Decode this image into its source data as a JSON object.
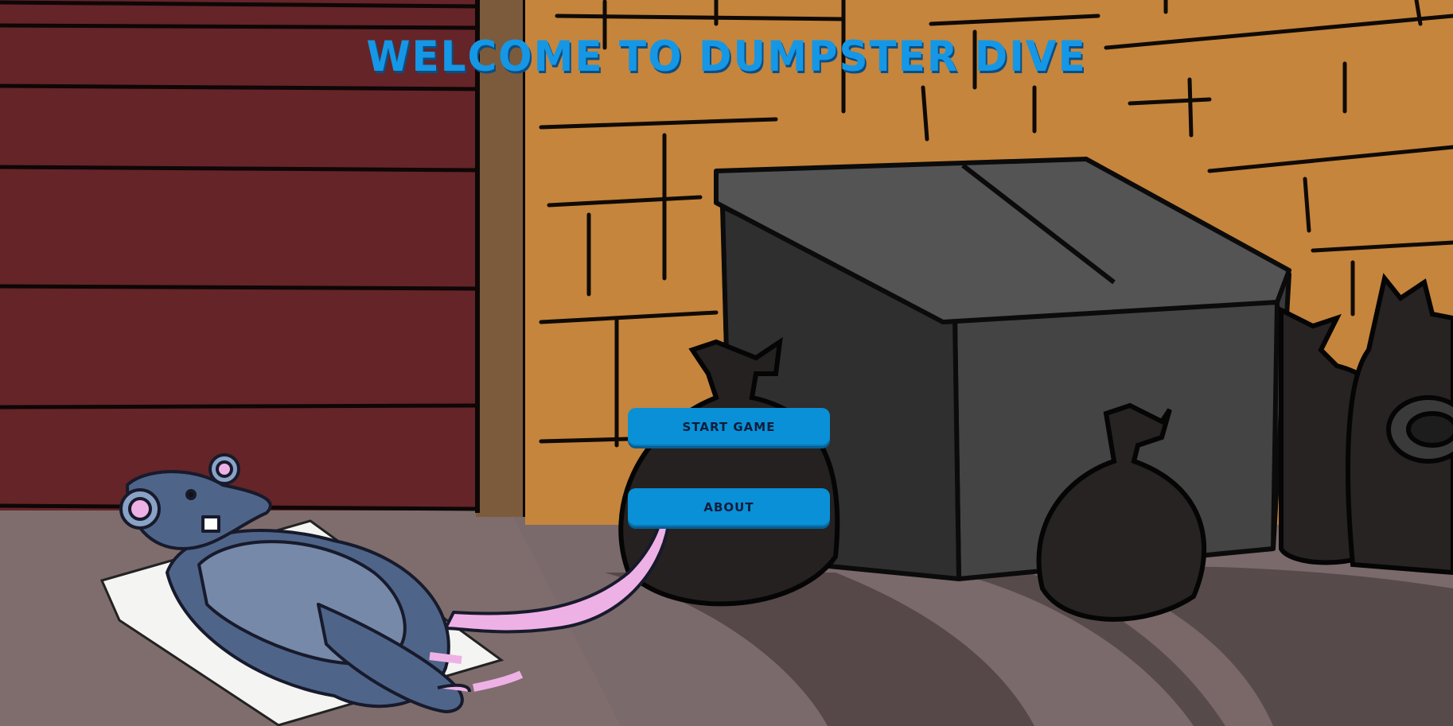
{
  "title": "Welcome to Dumpster Dive",
  "menu": {
    "start_label": "Start Game",
    "about_label": "About"
  },
  "colors": {
    "title": "#1597e5",
    "button": "#0a90d6",
    "button_text": "#0f1d3d",
    "wall_red": "#652427",
    "wall_brick": "#c5853c",
    "dumpster": "#4a4a4a",
    "ground": "#7b6a6b",
    "rat_fur": "#4f6489",
    "rat_pink": "#eeb1e6"
  }
}
